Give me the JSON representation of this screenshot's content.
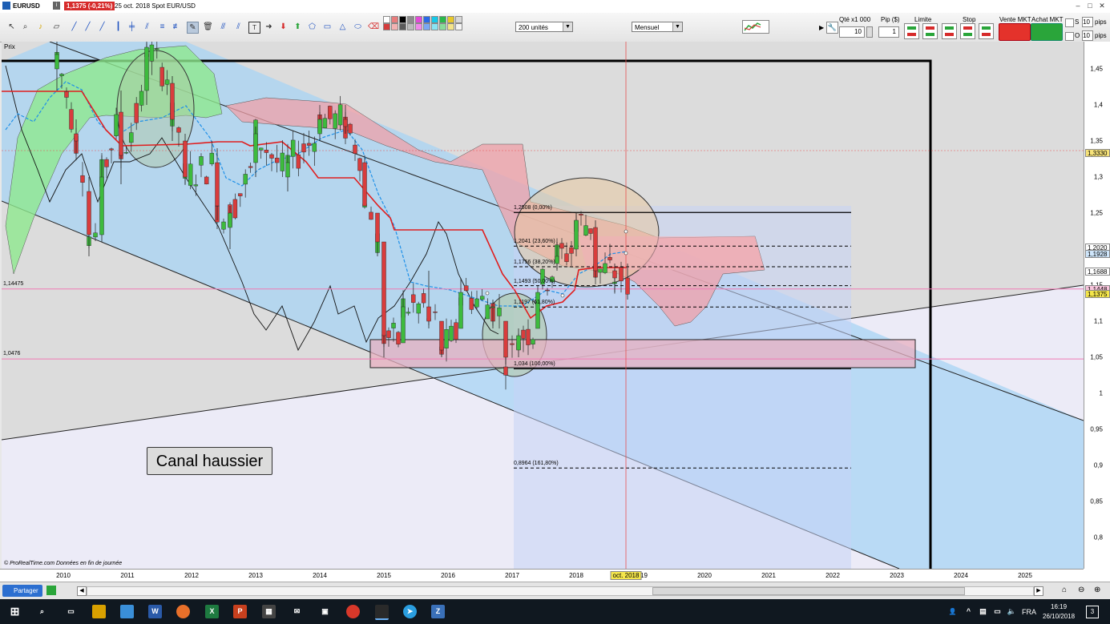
{
  "window": {
    "symbol": "EURUSD",
    "price_change": "1,1375 (-0,21%)",
    "date_line": "25 oct. 2018  Spot EUR/USD",
    "win_min": "–",
    "win_max": "□",
    "win_close": "✕"
  },
  "toolbar": {
    "units_select": "200 unités",
    "period_select": "Mensuel",
    "qty_label": "Qté x1 000",
    "qty_value": "10",
    "pip_label": "Pip ($)",
    "pip_value": "1",
    "limit_label": "Limite",
    "stop_label": "Stop",
    "sell_label": "Vente MKT",
    "buy_label": "Achat MKT",
    "s_label": "S",
    "o_label": "O",
    "pips_top_value": "10",
    "pips_top_label": "pips",
    "pips_bottom_value": "10",
    "pips_bottom_label": "pips",
    "swatch_colors": [
      "#ffffff",
      "#d43c3c",
      "#e87c7c",
      "#f2b2b2",
      "#000000",
      "#5a5a5a",
      "#8c8c8c",
      "#bbbbbb",
      "#e24ad8",
      "#f08aea",
      "#2a6ae8",
      "#7aa8f4",
      "#16c8e8",
      "#8ae4f4",
      "#2bb84a",
      "#8adc9a",
      "#e8c82a",
      "#f4e48a",
      "#d8d8d8",
      "#f4f4f4"
    ]
  },
  "chart": {
    "price_label": "Prix",
    "left_label_1": "1,14475",
    "left_label_2": "1,0476",
    "annotation": "Canal haussier",
    "copyright": "© ProRealTime.com  Données en fin de journée",
    "cursor_date": "oct. 2018",
    "fib_labels": [
      "1,2508 (0,00%)",
      "1,2041 (23,60%)",
      "1,1756 (38,20%)",
      "1,1493 (50,00%)",
      "1,1197 (61,80%)",
      "1,034 (100,00%)",
      "0,8964 (161,80%)"
    ],
    "colors": {
      "bull": "#3dbb3d",
      "bear": "#d93c3c",
      "kijun": "#e01e1e",
      "tenkan": "#1e90e8",
      "cloud_bull": "#8ee88e",
      "cloud_bear": "#f0a0a8",
      "channel": "#a8d4f4",
      "hline": "#f07ab4"
    }
  },
  "chart_data": {
    "type": "candlestick",
    "title": "EURUSD",
    "timeframe": "Mensuel",
    "x_axis_years": [
      "2010",
      "2011",
      "2012",
      "2013",
      "2014",
      "2015",
      "2016",
      "2017",
      "2018",
      "2019",
      "2020",
      "2021",
      "2022",
      "2023",
      "2024",
      "2025"
    ],
    "y_ticks": [
      "1,45",
      "1,4",
      "1,35",
      "1,3",
      "1,25",
      "1,2",
      "1,15",
      "1,1",
      "1,05",
      "1",
      "0,95",
      "0,9",
      "0,85",
      "0,8"
    ],
    "ylim": [
      0.76,
      1.48
    ],
    "price_badges": [
      {
        "value": "1,3330",
        "color": "#f7e37a"
      },
      {
        "value": "1,2020",
        "color": "#ffffff"
      },
      {
        "value": "1,1928",
        "color": "#cfe6fb"
      },
      {
        "value": "1,1688",
        "color": "#ffffff"
      },
      {
        "value": "1,1448",
        "color": "#f9c5dd"
      },
      {
        "value": "1,1375",
        "color": "#f4e64b"
      }
    ],
    "horizontal_levels": [
      1.14475,
      1.0476
    ],
    "fibonacci": [
      {
        "ratio": "0,00%",
        "value": 1.2508
      },
      {
        "ratio": "23,60%",
        "value": 1.2041
      },
      {
        "ratio": "38,20%",
        "value": 1.1756
      },
      {
        "ratio": "50,00%",
        "value": 1.1493
      },
      {
        "ratio": "61,80%",
        "value": 1.1197
      },
      {
        "ratio": "100,00%",
        "value": 1.034
      },
      {
        "ratio": "161,80%",
        "value": 0.8964
      }
    ],
    "monthly_candles_approx": [
      {
        "t": 2009.9,
        "o": 1.45,
        "h": 1.5,
        "l": 1.42,
        "c": 1.47
      },
      {
        "t": 2010.2,
        "o": 1.36,
        "h": 1.38,
        "l": 1.33,
        "c": 1.35
      },
      {
        "t": 2010.4,
        "o": 1.28,
        "h": 1.3,
        "l": 1.19,
        "c": 1.22
      },
      {
        "t": 2010.6,
        "o": 1.22,
        "h": 1.33,
        "l": 1.21,
        "c": 1.3
      },
      {
        "t": 2010.9,
        "o": 1.39,
        "h": 1.42,
        "l": 1.29,
        "c": 1.33
      },
      {
        "t": 2011.3,
        "o": 1.42,
        "h": 1.49,
        "l": 1.4,
        "c": 1.48
      },
      {
        "t": 2011.7,
        "o": 1.43,
        "h": 1.44,
        "l": 1.35,
        "c": 1.38
      },
      {
        "t": 2011.9,
        "o": 1.35,
        "h": 1.36,
        "l": 1.29,
        "c": 1.3
      },
      {
        "t": 2012.4,
        "o": 1.32,
        "h": 1.34,
        "l": 1.24,
        "c": 1.26
      },
      {
        "t": 2012.6,
        "o": 1.23,
        "h": 1.26,
        "l": 1.2,
        "c": 1.25
      },
      {
        "t": 2013.0,
        "o": 1.32,
        "h": 1.37,
        "l": 1.3,
        "c": 1.36
      },
      {
        "t": 2013.5,
        "o": 1.3,
        "h": 1.33,
        "l": 1.28,
        "c": 1.32
      },
      {
        "t": 2014.0,
        "o": 1.36,
        "h": 1.39,
        "l": 1.35,
        "c": 1.38
      },
      {
        "t": 2014.4,
        "o": 1.38,
        "h": 1.4,
        "l": 1.36,
        "c": 1.37
      },
      {
        "t": 2014.7,
        "o": 1.32,
        "h": 1.33,
        "l": 1.26,
        "c": 1.26
      },
      {
        "t": 2014.9,
        "o": 1.25,
        "h": 1.25,
        "l": 1.19,
        "c": 1.21
      },
      {
        "t": 2015.0,
        "o": 1.21,
        "h": 1.21,
        "l": 1.05,
        "c": 1.08
      },
      {
        "t": 2015.3,
        "o": 1.07,
        "h": 1.14,
        "l": 1.07,
        "c": 1.12
      },
      {
        "t": 2015.7,
        "o": 1.12,
        "h": 1.17,
        "l": 1.09,
        "c": 1.1
      },
      {
        "t": 2015.9,
        "o": 1.1,
        "h": 1.1,
        "l": 1.05,
        "c": 1.06
      },
      {
        "t": 2016.2,
        "o": 1.09,
        "h": 1.16,
        "l": 1.09,
        "c": 1.14
      },
      {
        "t": 2016.7,
        "o": 1.12,
        "h": 1.13,
        "l": 1.09,
        "c": 1.12
      },
      {
        "t": 2016.9,
        "o": 1.1,
        "h": 1.1,
        "l": 1.04,
        "c": 1.05
      },
      {
        "t": 2017.1,
        "o": 1.06,
        "h": 1.09,
        "l": 1.05,
        "c": 1.08
      },
      {
        "t": 2017.4,
        "o": 1.09,
        "h": 1.15,
        "l": 1.09,
        "c": 1.14
      },
      {
        "t": 2017.7,
        "o": 1.18,
        "h": 1.21,
        "l": 1.17,
        "c": 1.19
      },
      {
        "t": 2018.0,
        "o": 1.2,
        "h": 1.25,
        "l": 1.19,
        "c": 1.24
      },
      {
        "t": 2018.3,
        "o": 1.23,
        "h": 1.24,
        "l": 1.16,
        "c": 1.17
      },
      {
        "t": 2018.6,
        "o": 1.17,
        "h": 1.18,
        "l": 1.14,
        "c": 1.16
      },
      {
        "t": 2018.8,
        "o": 1.16,
        "h": 1.18,
        "l": 1.13,
        "c": 1.1375
      }
    ]
  },
  "statusbar": {
    "share_label": "Partager"
  },
  "taskbar": {
    "lang": "FRA",
    "time": "16:19",
    "date": "26/10/2018",
    "notif_count": "3"
  }
}
